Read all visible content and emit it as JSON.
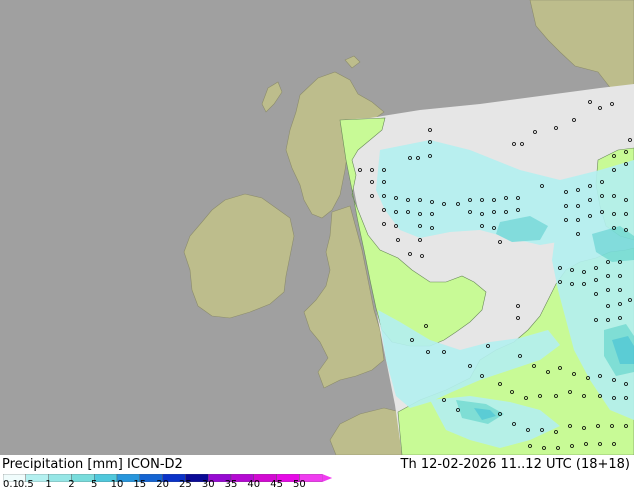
{
  "header": {
    "title": "Precipitation [mm]  ICON-D2",
    "run_info": "Th 12-02-2026 11..12 UTC (18+18)"
  },
  "legend": {
    "ticks": [
      "0.1",
      "0.5",
      "1",
      "2",
      "5",
      "10",
      "15",
      "20",
      "25",
      "30",
      "35",
      "40",
      "45",
      "50"
    ],
    "colors": [
      "#f0fcfc",
      "#b4f0f0",
      "#96e6e6",
      "#78dcdc",
      "#50c8dc",
      "#2896dc",
      "#1464d2",
      "#0a32c8",
      "#0a0a96",
      "#960ad2",
      "#b40ad2",
      "#d20ad2",
      "#e60ae6",
      "#f03cf0"
    ]
  },
  "map": {
    "colors": {
      "sea": "#a0a0a0",
      "land_outside": "#bdbd8c",
      "domain_sea": "#e6e6e6",
      "land_dry": "#c8fa96",
      "precip_light": "#b4f0f0",
      "precip_medium": "#78dcdc",
      "precip_heavy": "#50c8dc"
    }
  }
}
